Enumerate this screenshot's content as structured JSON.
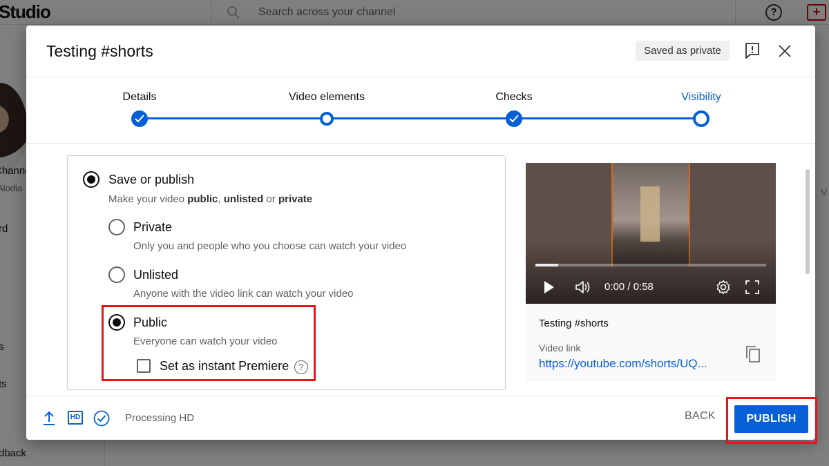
{
  "background": {
    "logo_text": "Studio",
    "search_placeholder": "Search across your channel",
    "help_symbol": "?",
    "sidebar_channel": "Channel",
    "sidebar_channel_sub": "Alodia",
    "sidebar_item_dashboard": "rd",
    "sidebar_item_s": "s",
    "sidebar_item_ts": "ts",
    "sidebar_item_feedback": "dback",
    "right_edge_text": "V"
  },
  "dialog": {
    "title": "Testing #shorts",
    "saved_badge": "Saved as private"
  },
  "stepper": {
    "steps": [
      {
        "label": "Details",
        "state": "done"
      },
      {
        "label": "Video elements",
        "state": "open"
      },
      {
        "label": "Checks",
        "state": "done"
      },
      {
        "label": "Visibility",
        "state": "current"
      }
    ]
  },
  "visibility": {
    "section_title": "Save or publish",
    "section_sub_prefix": "Make your video ",
    "section_sub_public": "public",
    "section_sub_comma": ", ",
    "section_sub_unlisted": "unlisted",
    "section_sub_or": " or ",
    "section_sub_private": "private",
    "options": [
      {
        "label": "Private",
        "description": "Only you and people who you choose can watch your video",
        "checked": false
      },
      {
        "label": "Unlisted",
        "description": "Anyone with the video link can watch your video",
        "checked": false
      },
      {
        "label": "Public",
        "description": "Everyone can watch your video",
        "checked": true
      }
    ],
    "premiere_label": "Set as instant Premiere",
    "premiere_help": "?"
  },
  "preview": {
    "time": "0:00 / 0:58",
    "progress_fraction": 0.1,
    "title": "Testing #shorts",
    "link_label": "Video link",
    "link_url": "https://youtube.com/shorts/UQ..."
  },
  "footer": {
    "hd_badge": "HD",
    "status": "Processing HD",
    "back_label": "BACK",
    "publish_label": "PUBLISH"
  },
  "colors": {
    "accent_blue": "#065fd4",
    "highlight_red": "#e8141c"
  }
}
